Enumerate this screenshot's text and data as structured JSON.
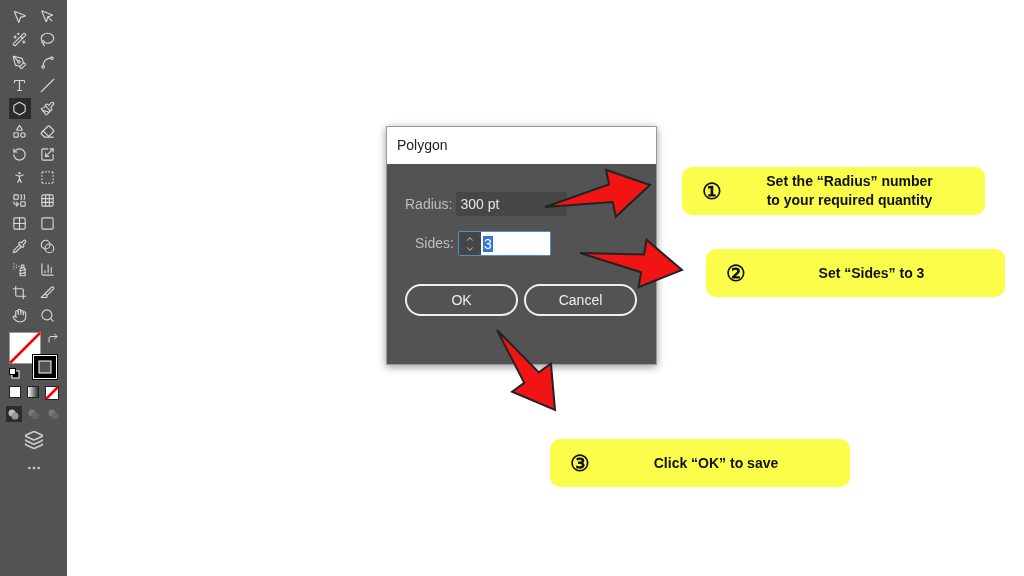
{
  "toolbar": {
    "tools": [
      {
        "selected": false
      },
      {
        "selected": false
      },
      {
        "selected": false
      },
      {
        "selected": false
      },
      {
        "selected": false
      },
      {
        "selected": false
      },
      {
        "selected": false
      },
      {
        "selected": false
      },
      {
        "selected": true
      },
      {
        "selected": false
      },
      {
        "selected": false
      },
      {
        "selected": false
      },
      {
        "selected": false
      },
      {
        "selected": false
      },
      {
        "selected": false
      },
      {
        "selected": false
      },
      {
        "selected": false
      },
      {
        "selected": false
      },
      {
        "selected": false
      },
      {
        "selected": false
      },
      {
        "selected": false
      },
      {
        "selected": false
      },
      {
        "selected": false
      },
      {
        "selected": false
      },
      {
        "selected": false
      },
      {
        "selected": false
      },
      {
        "selected": false
      },
      {
        "selected": false
      }
    ],
    "draw_modes": [
      {
        "selected": true
      },
      {
        "selected": false
      },
      {
        "selected": false
      }
    ]
  },
  "dialog": {
    "title": "Polygon",
    "radius": {
      "label": "Radius:",
      "value": "300 pt"
    },
    "sides": {
      "label": "Sides:",
      "value": "3",
      "text_selected": true
    },
    "buttons": [
      "OK",
      "Cancel"
    ]
  },
  "callouts": [
    {
      "number": "①",
      "text": "Set the “Radius” number\nto your required quantity"
    },
    {
      "number": "②",
      "text": "Set “Sides” to 3"
    },
    {
      "number": "③",
      "text": "Click “OK” to save"
    }
  ]
}
